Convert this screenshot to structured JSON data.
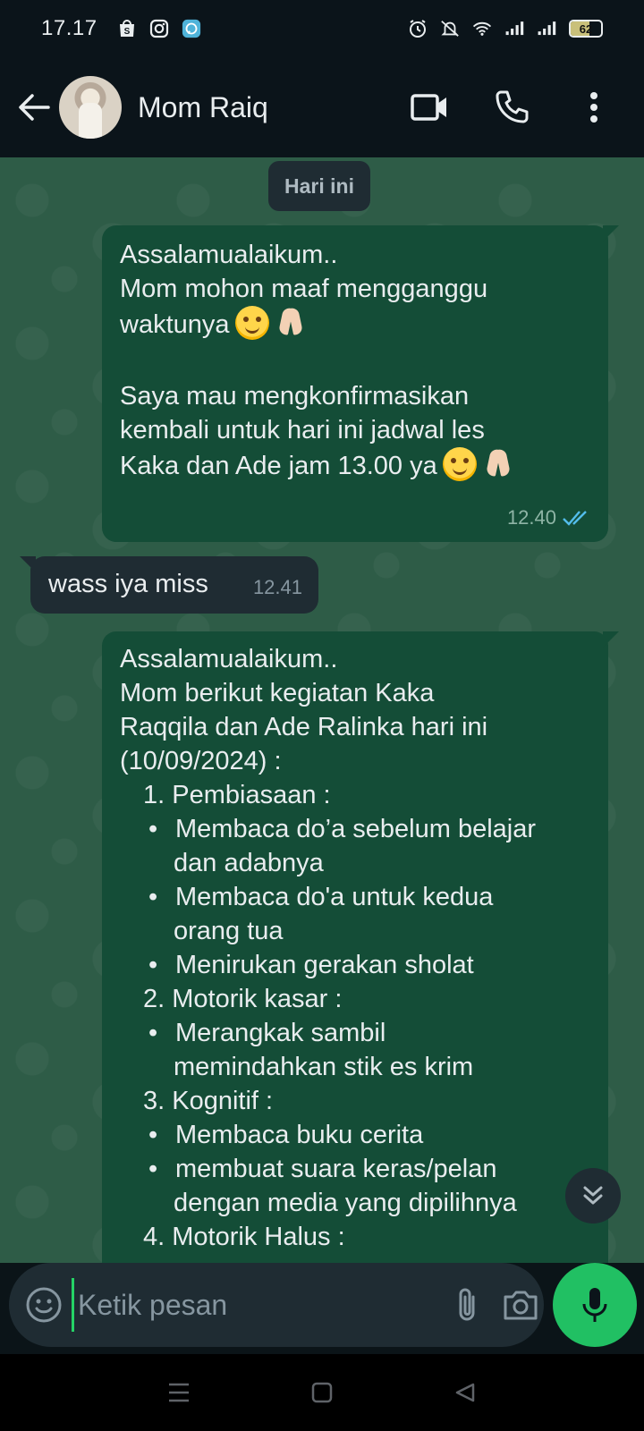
{
  "status_bar": {
    "time": "17.17",
    "battery_level": "62",
    "icons": [
      "shopee-icon",
      "instagram-icon",
      "messenger-icon",
      "alarm-icon",
      "mute-icon",
      "wifi-icon",
      "signal-icon",
      "signal-icon",
      "battery-icon"
    ]
  },
  "header": {
    "contact_name": "Mom Raiq"
  },
  "chat": {
    "date_chip": "Hari ini",
    "messages": [
      {
        "direction": "outgoing",
        "lines": [
          "Assalamualaikum..",
          "Mom mohon maaf mengganggu",
          "waktunya",
          "",
          "Saya mau mengkonfirmasikan",
          "kembali untuk hari ini jadwal les",
          "Kaka dan Ade jam 13.00 ya"
        ],
        "time": "12.40",
        "read": true
      },
      {
        "direction": "incoming",
        "text": "wass iya miss",
        "time": "12.41"
      },
      {
        "direction": "outgoing",
        "intro": [
          "Assalamualaikum..",
          "Mom berikut kegiatan Kaka",
          "Raqqila dan Ade Ralinka hari ini",
          "(10/09/2024) :"
        ],
        "items": [
          {
            "num": "1. Pembiasaan :",
            "bullets": [
              [
                "Membaca do’a sebelum belajar",
                "dan adabnya"
              ],
              [
                "Membaca do'a untuk kedua",
                "orang tua"
              ],
              [
                "Menirukan gerakan sholat"
              ]
            ]
          },
          {
            "num": "2. Motorik kasar :",
            "bullets": [
              [
                "Merangkak sambil",
                "memindahkan stik es krim"
              ]
            ]
          },
          {
            "num": "3. Kognitif :",
            "bullets": [
              [
                "Membaca buku cerita"
              ],
              [
                "membuat suara keras/pelan",
                "dengan media yang dipilihnya"
              ]
            ]
          },
          {
            "num": "4. Motorik Halus :"
          }
        ]
      }
    ]
  },
  "input_bar": {
    "placeholder": "Ketik pesan"
  },
  "colors": {
    "outgoing_bubble": "#144d37",
    "incoming_bubble": "#1f2c33",
    "accent": "#21c063",
    "read_ticks": "#53bdeb"
  }
}
